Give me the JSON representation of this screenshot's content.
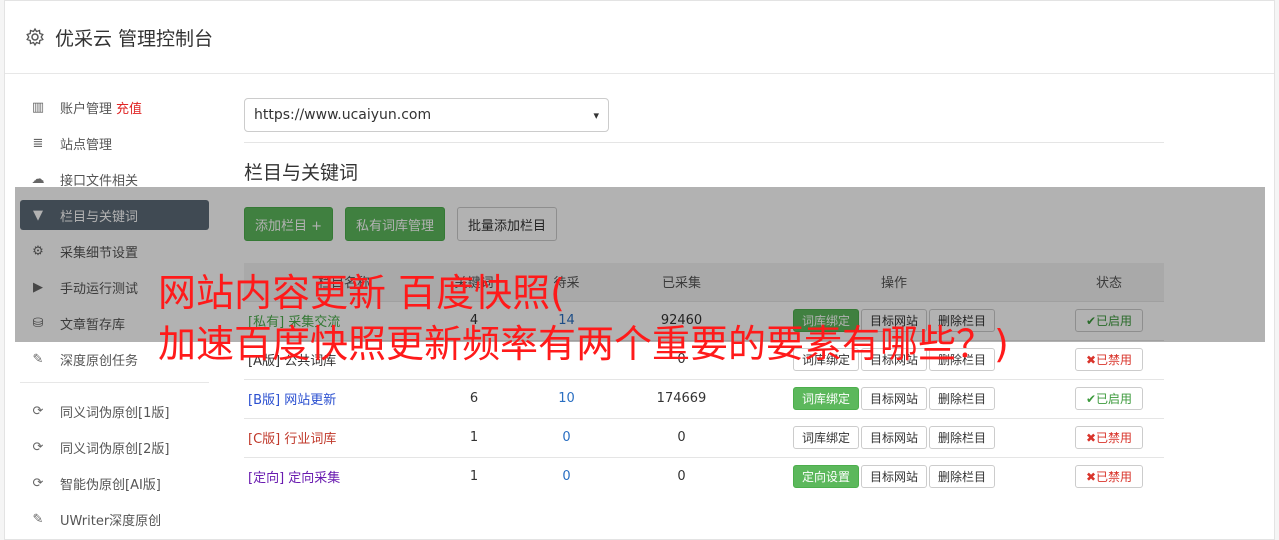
{
  "header": {
    "title": "优采云 管理控制台"
  },
  "sidebar": {
    "items": [
      {
        "label": "账户管理",
        "extra": "充值",
        "icon": "bar-chart-icon"
      },
      {
        "label": "站点管理",
        "icon": "server-icon"
      },
      {
        "label": "接口文件相关",
        "icon": "cloud-upload-icon"
      },
      {
        "label": "栏目与关键词",
        "icon": "filter-icon",
        "active": true
      },
      {
        "label": "采集细节设置",
        "icon": "gears-icon"
      },
      {
        "label": "手动运行测试",
        "icon": "play-circle-icon"
      },
      {
        "label": "文章暂存库",
        "icon": "database-icon"
      },
      {
        "label": "深度原创任务",
        "icon": "edit-icon"
      }
    ],
    "items2": [
      {
        "label": "同义词伪原创[1版]",
        "icon": "refresh-icon"
      },
      {
        "label": "同义词伪原创[2版]",
        "icon": "refresh-icon"
      },
      {
        "label": "智能伪原创[AI版]",
        "icon": "refresh-icon"
      },
      {
        "label": "UWriter深度原创",
        "icon": "edit-icon"
      }
    ]
  },
  "main": {
    "site_select": "https://www.ucaiyun.com",
    "section_title": "栏目与关键词",
    "buttons": {
      "add": "添加栏目 +",
      "private": "私有词库管理",
      "batch": "批量添加栏目"
    },
    "table": {
      "headers": [
        "栏目名称",
        "关键词",
        "待采",
        "已采集",
        "操作",
        "状态"
      ],
      "rows": [
        {
          "tag": "[私有]",
          "name": "采集交流",
          "kw": "4",
          "pending": "14",
          "collected": "92460",
          "op1": "词库绑定",
          "op2": "目标网站",
          "op3": "删除栏目",
          "status": "✔已启用",
          "state": "on",
          "op1green": true,
          "cls": "tag-private"
        },
        {
          "tag": "[A版]",
          "name": "公共词库",
          "kw": "",
          "pending": "",
          "collected": "0",
          "op1": "词库绑定",
          "op2": "目标网站",
          "op3": "删除栏目",
          "status": "✖已禁用",
          "state": "off",
          "op1green": false,
          "cls": "tag-a"
        },
        {
          "tag": "[B版]",
          "name": "网站更新",
          "kw": "6",
          "pending": "10",
          "collected": "174669",
          "op1": "词库绑定",
          "op2": "目标网站",
          "op3": "删除栏目",
          "status": "✔已启用",
          "state": "on",
          "op1green": true,
          "cls": "tag-b"
        },
        {
          "tag": "[C版]",
          "name": "行业词库",
          "kw": "1",
          "pending": "0",
          "collected": "0",
          "op1": "词库绑定",
          "op2": "目标网站",
          "op3": "删除栏目",
          "status": "✖已禁用",
          "state": "off",
          "op1green": false,
          "cls": "tag-c"
        },
        {
          "tag": "[定向]",
          "name": "定向采集",
          "kw": "1",
          "pending": "0",
          "collected": "0",
          "op1": "定向设置",
          "op2": "目标网站",
          "op3": "删除栏目",
          "status": "✖已禁用",
          "state": "off",
          "op1green": true,
          "cls": "tag-d"
        }
      ]
    }
  },
  "overlay": {
    "line1": "网站内容更新 百度快照(",
    "line2": "加速百度快照更新频率有两个重要的要素有哪些？)"
  }
}
